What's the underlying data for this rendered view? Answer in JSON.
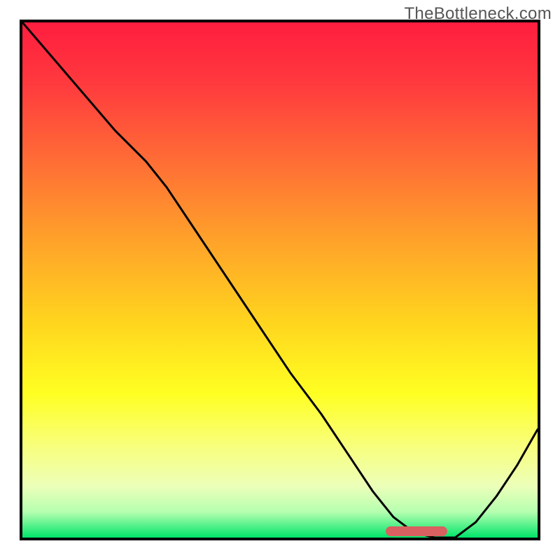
{
  "watermark": "TheBottleneck.com",
  "gradient_stops": [
    {
      "pct": 0,
      "color": "#ff1d3f"
    },
    {
      "pct": 12,
      "color": "#ff3a3e"
    },
    {
      "pct": 26,
      "color": "#ff6a36"
    },
    {
      "pct": 42,
      "color": "#ffa12a"
    },
    {
      "pct": 58,
      "color": "#ffd41e"
    },
    {
      "pct": 72,
      "color": "#ffff22"
    },
    {
      "pct": 82,
      "color": "#f8ff7a"
    },
    {
      "pct": 90,
      "color": "#ecffb9"
    },
    {
      "pct": 95,
      "color": "#b6ffb0"
    },
    {
      "pct": 100,
      "color": "#00e56a"
    }
  ],
  "marker": {
    "x_start_pct": 70.5,
    "x_end_pct": 82.5
  },
  "chart_data": {
    "type": "line",
    "title": "",
    "xlabel": "",
    "ylabel": "",
    "xlim": [
      0,
      100
    ],
    "ylim": [
      0,
      100
    ],
    "x": [
      0,
      6,
      12,
      18,
      24,
      28,
      34,
      40,
      46,
      52,
      58,
      64,
      68,
      72,
      76,
      80,
      84,
      88,
      92,
      96,
      100
    ],
    "values": [
      100,
      93,
      86,
      79,
      73,
      68,
      59,
      50,
      41,
      32,
      24,
      15,
      9,
      4,
      1,
      0,
      0,
      3,
      8,
      14,
      21
    ],
    "series": [
      {
        "name": "bottleneck-curve",
        "values": [
          100,
          93,
          86,
          79,
          73,
          68,
          59,
          50,
          41,
          32,
          24,
          15,
          9,
          4,
          1,
          0,
          0,
          3,
          8,
          14,
          21
        ]
      }
    ],
    "optimum_range_x": [
      70.5,
      82.5
    ],
    "annotations": []
  }
}
